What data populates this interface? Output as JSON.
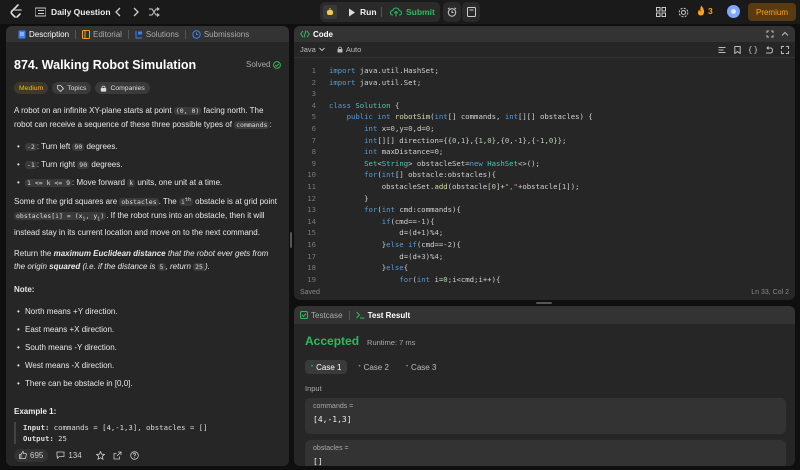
{
  "topbar": {
    "title": "Daily Question",
    "run_label": "Run",
    "submit_label": "Submit",
    "streak": "3",
    "premium_label": "Premium"
  },
  "left": {
    "tabs": [
      "Description",
      "Editorial",
      "Solutions",
      "Submissions"
    ],
    "problem_title": "874. Walking Robot Simulation",
    "solved_label": "Solved",
    "difficulty": "Medium",
    "topics_label": "Topics",
    "companies_label": "Companies",
    "p1_a": "A robot on an infinite XY-plane starts at point ",
    "p1_code1": "(0, 0)",
    "p1_b": " facing north. The robot can receive a sequence of these three possible types of ",
    "p1_code2": "commands",
    "p1_c": ":",
    "cmds": [
      {
        "code": "-2",
        "text": ": Turn left ",
        "code2": "90",
        "text2": " degrees."
      },
      {
        "code": "-1",
        "text": ": Turn right ",
        "code2": "90",
        "text2": " degrees."
      },
      {
        "code": "1 <= k <= 9",
        "text": ": Move forward ",
        "code2": "k",
        "text2": " units, one unit at a time."
      }
    ],
    "p2_a": "Some of the grid squares are ",
    "p2_code1": "obstacles",
    "p2_b": ". The ",
    "p2_code2": "i",
    "p2_sup": "th",
    "p2_c": " obstacle is at grid point ",
    "p2_code3": "obstacles[i] = (x",
    "p2_code3_sub1": "i",
    "p2_code3_mid": ", y",
    "p2_code3_sub2": "i",
    "p2_code3_end": ")",
    "p2_d": ". If the robot runs into an obstacle, then it will instead stay in its current location and move on to the next command.",
    "p3_a": "Return the ",
    "p3_b": "maximum Euclidean distance",
    "p3_c": " that the robot ever gets from the origin ",
    "p3_d": "squared",
    "p3_e": " (i.e. if the distance is ",
    "p3_code1": "5",
    "p3_f": ", return ",
    "p3_code2": "25",
    "p3_g": ").",
    "note_label": "Note:",
    "notes": [
      "North means +Y direction.",
      "East means +X direction.",
      "South means -Y direction.",
      "West means -X direction.",
      "There can be obstacle in [0,0]."
    ],
    "example_label": "Example 1:",
    "ex_input_label": "Input:",
    "ex_input": " commands = [4,-1,3], obstacles = []",
    "ex_output_label": "Output:",
    "ex_output": " 25",
    "likes": "695",
    "comments": "134"
  },
  "code": {
    "header": "Code",
    "language": "Java",
    "auto_label": "Auto",
    "status_left": "Saved",
    "status_right": "Ln 33, Col 2",
    "line_numbers": [
      "1",
      "2",
      "3",
      "4",
      "5",
      "6",
      "7",
      "8",
      "9",
      "10",
      "11",
      "12",
      "13",
      "14",
      "15",
      "16",
      "17",
      "18",
      "19"
    ]
  },
  "result": {
    "tabs": [
      "Testcase",
      "Test Result"
    ],
    "accepted": "Accepted",
    "runtime": "Runtime: 7 ms",
    "cases": [
      "Case 1",
      "Case 2",
      "Case 3"
    ],
    "input_label": "Input",
    "var1_name": "commands =",
    "var1_value": "[4,-1,3]",
    "var2_name": "obstacles =",
    "var2_value": "[]"
  },
  "colors": {
    "accent": "#ffa116",
    "accepted": "#2cbb5d",
    "bg": "#0f0f0f",
    "panel": "#262626"
  },
  "icons": [
    "logo-icon",
    "list-icon",
    "chevron-left-icon",
    "chevron-right-icon",
    "shuffle-icon",
    "play-icon",
    "upload-cloud-icon",
    "alarm-icon",
    "note-icon",
    "grid-icon",
    "gear-icon",
    "fire-icon",
    "avatar",
    "description-icon",
    "editorial-icon",
    "solutions-icon",
    "submissions-icon",
    "check-circle-icon",
    "tag-icon",
    "lock-icon",
    "code-icon",
    "expand-icon",
    "chevron-up-icon",
    "format-icon",
    "bookmark-icon",
    "braces-icon",
    "undo-icon",
    "fullscreen-icon",
    "testcase-check-icon",
    "terminal-icon",
    "thumb-up-icon",
    "comment-icon",
    "star-icon",
    "share-icon",
    "help-icon"
  ]
}
